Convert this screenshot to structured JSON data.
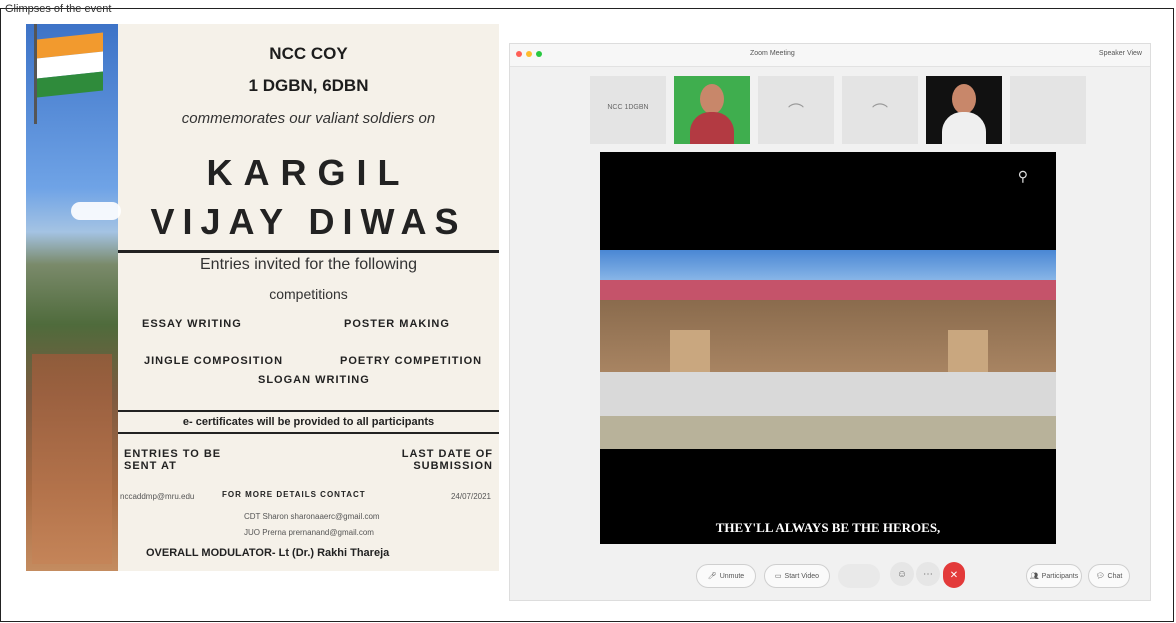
{
  "header": {
    "text": "Glimpses of the event"
  },
  "poster": {
    "line1": "NCC COY",
    "line2": "1 DGBN, 6DBN",
    "line3": "commemorates our valiant soldiers on",
    "title1": "KARGIL",
    "title2": "VIJAY DIWAS",
    "entries": "Entries invited for the following",
    "competitions": "competitions",
    "comp1": "ESSAY WRITING",
    "comp2": "POSTER MAKING",
    "comp3": "JINGLE COMPOSITION",
    "comp4": "POETRY COMPETITION",
    "comp5": "SLOGAN WRITING",
    "ecert": "e- certificates will be provided to all participants",
    "entries_sent": "ENTRIES TO BE SENT AT",
    "last_date": "LAST DATE OF SUBMISSION",
    "email": "nccaddmp@mru.edu",
    "details": "FOR MORE DETAILS CONTACT",
    "date": "24/07/2021",
    "contact1": "CDT Sharon sharonaaerc@gmail.com",
    "contact2": "JUO Prerna prernanand@gmail.com",
    "moderator": "OVERALL MODULATOR- Lt (Dr.) Rakhi Thareja"
  },
  "zoom": {
    "window_title": "Zoom Meeting",
    "toolbar_right": "Speaker View",
    "thumb1_label": "NCC 1DGBN",
    "caption": "THEY'LL ALWAYS BE THE HEROES,",
    "unmute": "Unmute",
    "start_video": "Start Video",
    "participants": "Participants",
    "chat": "Chat",
    "colors": {
      "end": "#e33a3a"
    }
  }
}
